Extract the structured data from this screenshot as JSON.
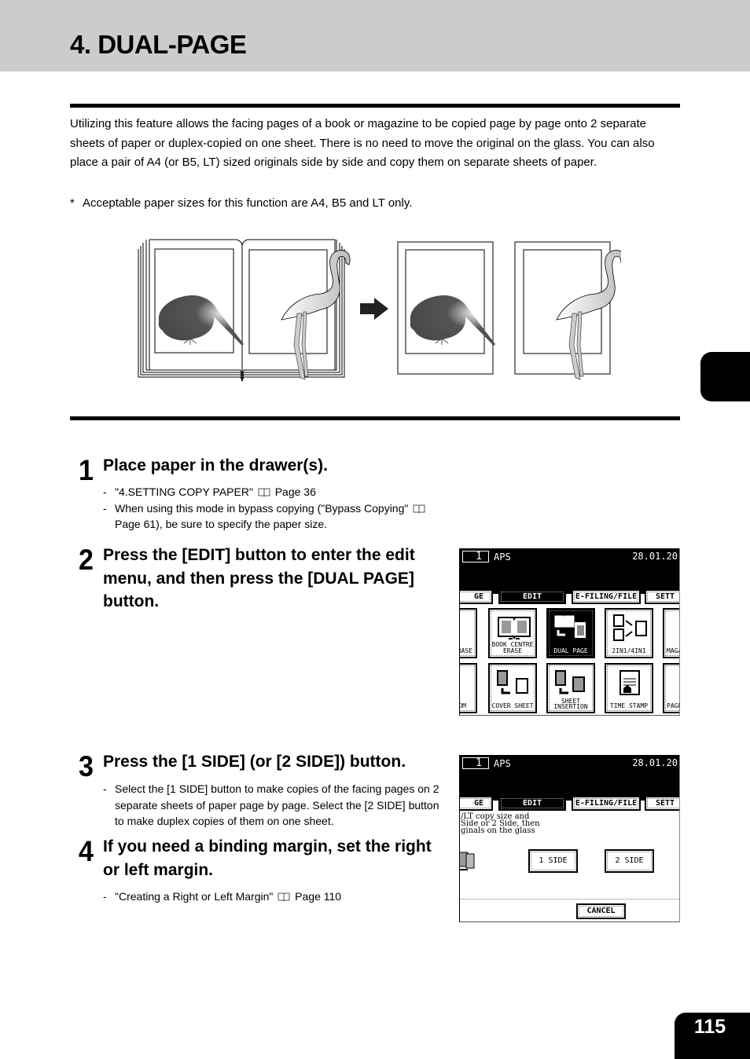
{
  "header": {
    "title": "4. DUAL-PAGE"
  },
  "intro": {
    "paragraph": "Utilizing this feature allows the facing pages of a book or magazine to be copied page by page onto 2 separate sheets of paper or duplex-copied on one sheet. There is no need to move the original on the glass. You can also place a pair of A4 (or B5, LT) sized originals side by side and copy them on separate sheets of paper.",
    "note_marker": "*",
    "note": "Acceptable paper sizes for this function are A4, B5 and LT only."
  },
  "illustration": {
    "description": "Open book with kiwi and flamingo pages copied onto two separate sheets",
    "arrow_icon": "right-arrow"
  },
  "steps": [
    {
      "number": "1",
      "title": "Place paper in the drawer(s).",
      "bullets": [
        {
          "dash": "-",
          "before": "\"4.SETTING COPY PAPER\"",
          "after": "Page 36"
        },
        {
          "dash": "-",
          "before": "When using this mode in bypass copying (\"Bypass Copying\"",
          "after": "Page 61), be sure to specify the paper size."
        }
      ]
    },
    {
      "number": "2",
      "title": "Press the [EDIT] button to enter the edit menu, and then press the [DUAL PAGE] button."
    },
    {
      "number": "3",
      "title": "Press the [1 SIDE] (or [2 SIDE]) button.",
      "bullets": [
        {
          "dash": "-",
          "text": "Select the [1 SIDE] button to make copies of the facing pages on 2 separate sheets of paper page by page. Select the [2 SIDE] button to make duplex copies of them on one sheet."
        }
      ]
    },
    {
      "number": "4",
      "title": "If you need a binding margin, set the right or left margin.",
      "bullets": [
        {
          "dash": "-",
          "before": "\"Creating a Right or Left Margin\"",
          "after": "Page 110"
        }
      ]
    }
  ],
  "screen1": {
    "count": "1",
    "mode": "APS",
    "date": "28.01.20",
    "tabs": [
      "GE",
      "EDIT",
      "E-FILING/FILE",
      "SETT"
    ],
    "active_tab": "EDIT",
    "buttons_row1": [
      "RASE",
      "BOOK CENTRE ERASE",
      "DUAL PAGE",
      "2IN1/4IN1",
      "MAGA"
    ],
    "buttons_row2": [
      "OM",
      "COVER SHEET",
      "SHEET INSERTION",
      "TIME STAMP",
      "PAGE"
    ],
    "selected_button": "DUAL PAGE"
  },
  "screen2": {
    "count": "1",
    "mode": "APS",
    "date": "28.01.20",
    "tabs": [
      "GE",
      "EDIT",
      "E-FILING/FILE",
      "SETT"
    ],
    "message_lines": [
      "/LT copy size and",
      "Side or 2 Side, then",
      "ginals on the glass"
    ],
    "option_1": "1 SIDE",
    "option_2": "2 SIDE",
    "cancel": "CANCEL"
  },
  "footer": {
    "page_number": "115"
  }
}
